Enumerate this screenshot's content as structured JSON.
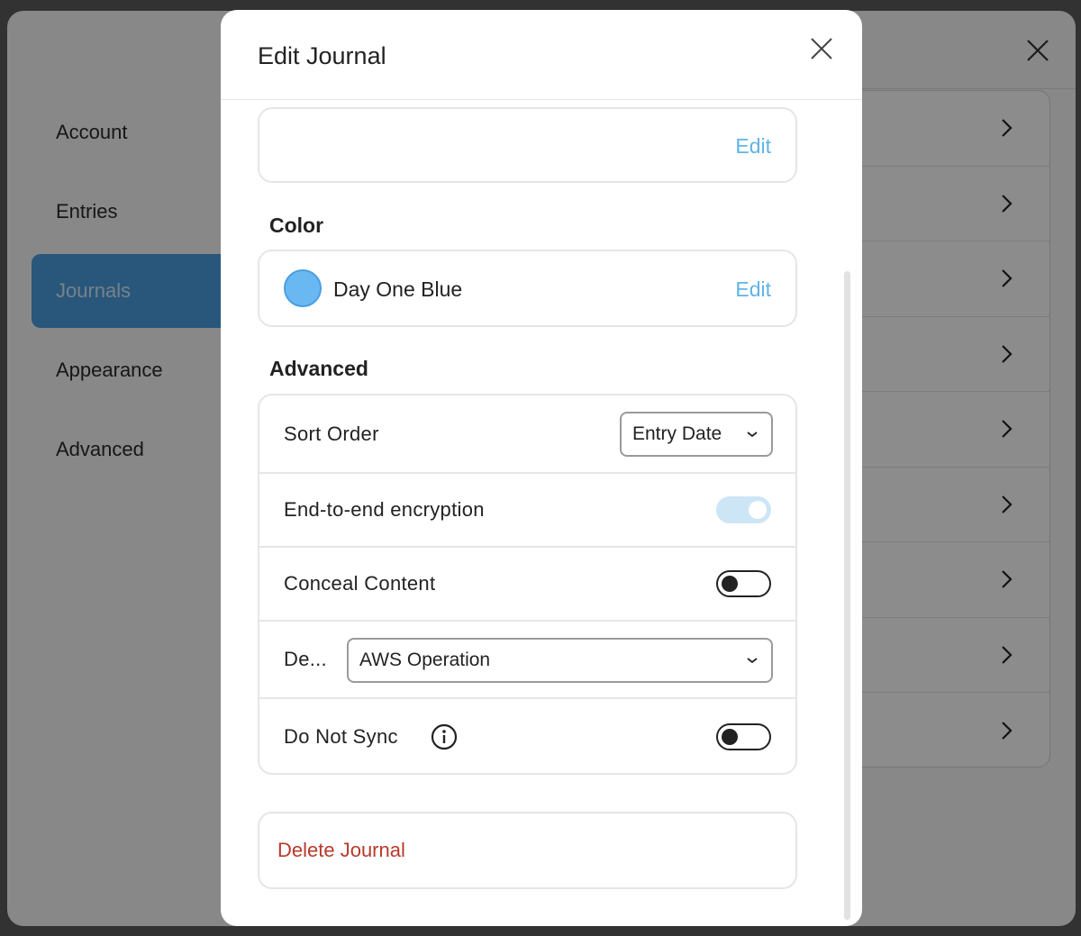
{
  "background": {
    "sidebar": {
      "items": [
        {
          "label": "Account"
        },
        {
          "label": "Entries"
        },
        {
          "label": "Journals",
          "active": true
        },
        {
          "label": "Appearance"
        },
        {
          "label": "Advanced"
        }
      ]
    },
    "journal_rows_count_visible": 9
  },
  "modal": {
    "title": "Edit Journal",
    "top_card": {
      "edit_label": "Edit"
    },
    "color_section": {
      "heading": "Color",
      "color_name": "Day One Blue",
      "color_hex": "#6ab8f2",
      "edit_label": "Edit"
    },
    "advanced_section": {
      "heading": "Advanced",
      "sort_order": {
        "label": "Sort Order",
        "value": "Entry Date"
      },
      "encryption": {
        "label": "End-to-end encryption",
        "enabled": true
      },
      "conceal": {
        "label": "Conceal Content",
        "enabled": false
      },
      "default_template": {
        "label": "De...",
        "value": "AWS Operation"
      },
      "do_not_sync": {
        "label": "Do Not Sync",
        "enabled": false
      }
    },
    "delete_label": "Delete Journal"
  },
  "colors": {
    "accent": "#61b4e4",
    "sidebar_active": "#4a9fe0",
    "danger": "#b8392a"
  }
}
